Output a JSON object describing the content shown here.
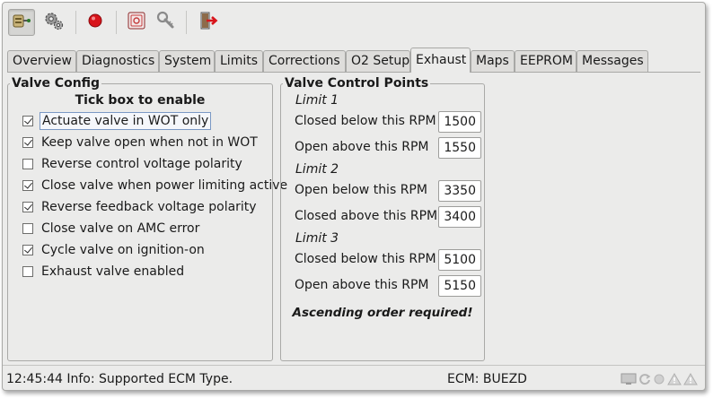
{
  "toolbar": {
    "buttons": [
      {
        "name": "connect-button",
        "icon": "ecu-connect-icon",
        "active": true
      },
      {
        "name": "settings-button",
        "icon": "gears-icon"
      },
      {
        "name": "stop-button",
        "icon": "red-record-icon"
      },
      {
        "name": "ecu-button",
        "icon": "ecu-module-icon"
      },
      {
        "name": "tools-button",
        "icon": "wrench-key-icon"
      },
      {
        "name": "exit-button",
        "icon": "exit-door-icon"
      }
    ]
  },
  "tabs": [
    "Overview",
    "Diagnostics",
    "System",
    "Limits",
    "Corrections",
    "O2 Setup",
    "Exhaust",
    "Maps",
    "EEPROM",
    "Messages"
  ],
  "selected_tab": "Exhaust",
  "valve_config": {
    "title": "Valve Config",
    "hint": "Tick box to enable",
    "options": [
      {
        "label": "Actuate valve in WOT only",
        "checked": true
      },
      {
        "label": "Keep valve open when not in WOT",
        "checked": true
      },
      {
        "label": "Reverse control voltage polarity",
        "checked": false
      },
      {
        "label": "Close valve when power limiting active",
        "checked": true
      },
      {
        "label": "Reverse feedback voltage polarity",
        "checked": true
      },
      {
        "label": "Close valve on AMC error",
        "checked": false
      },
      {
        "label": "Cycle valve on ignition-on",
        "checked": true
      },
      {
        "label": "Exhaust valve enabled",
        "checked": false
      }
    ]
  },
  "control_points": {
    "title": "Valve Control Points",
    "limits": [
      {
        "header": "Limit 1",
        "rows": [
          {
            "label": "Closed below this RPM",
            "value": "1500"
          },
          {
            "label": "Open above this RPM",
            "value": "1550"
          }
        ]
      },
      {
        "header": "Limit 2",
        "rows": [
          {
            "label": "Open below this RPM",
            "value": "3350"
          },
          {
            "label": "Closed above this RPM",
            "value": "3400"
          }
        ]
      },
      {
        "header": "Limit 3",
        "rows": [
          {
            "label": "Closed below this RPM",
            "value": "5100"
          },
          {
            "label": "Open above this RPM",
            "value": "5150"
          }
        ]
      }
    ],
    "note": "Ascending order required!"
  },
  "status": {
    "message": "12:45:44 Info: Supported ECM Type.",
    "ecm": "ECM: BUEZD",
    "icons": [
      "screen-icon",
      "refresh-icon",
      "circle-icon",
      "warning-icon",
      "alert-icon"
    ]
  },
  "colors": {
    "window_bg": "#ebebea",
    "record_red": "#d8141b"
  }
}
